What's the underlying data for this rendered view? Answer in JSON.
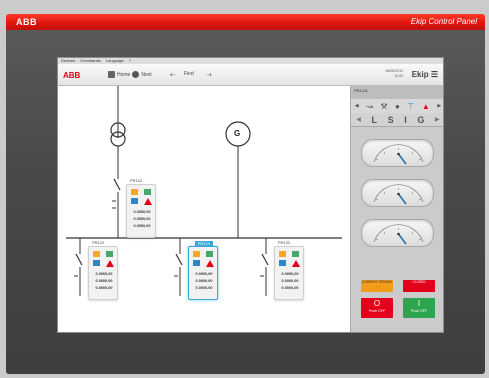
{
  "device": {
    "brand": "ABB",
    "panel_title": "Ekip Control Panel"
  },
  "menubar": {
    "items": [
      "Devices",
      "Commands",
      "Language",
      "?"
    ]
  },
  "toolbar": {
    "logo": "ABB",
    "home_label": "Home",
    "next_label": "Next",
    "back_icon": "arrow-left-icon",
    "forward_icon": "arrow-right-icon",
    "find_label": "Find",
    "status_line1": "06/05/2013",
    "status_line2": "10:00",
    "ekip_label": "Ekip"
  },
  "diagram": {
    "top_card": {
      "title": "PR122",
      "values": [
        "0.0000,00",
        "0.0000,00",
        "0.0000,00"
      ]
    },
    "generator_label": "G",
    "bottom_cards": [
      {
        "title": "PR122",
        "values": [
          "0.0000,00",
          "0.0000,00",
          "0.0000,00"
        ],
        "selected": false
      },
      {
        "title": "PR121",
        "values": [
          "0.0000,00",
          "0.0000,00",
          "0.0000,00"
        ],
        "selected": true
      },
      {
        "title": "PR122",
        "values": [
          "0.0000,00",
          "0.0000,00",
          "0.0000,00"
        ],
        "selected": false
      }
    ]
  },
  "right_panel": {
    "header": "PR121L",
    "tools": [
      "measure-icon",
      "wrench-icon",
      "dial-icon",
      "temperature-icon",
      "warning-icon"
    ],
    "tabs": [
      "L",
      "S",
      "I",
      "G"
    ],
    "gauges": [
      {
        "name": "gauge-current",
        "scale_labels": [
          "0",
          "50",
          "100"
        ]
      },
      {
        "name": "gauge-voltage",
        "scale_labels": [
          "0",
          "50",
          "100"
        ]
      },
      {
        "name": "gauge-power",
        "scale_labels": [
          "0",
          "50",
          "100"
        ]
      }
    ],
    "buttons": {
      "small_left": "CURRENT OPENED",
      "small_right": "CLOSED",
      "open_symbol": "O",
      "open_label": "Push OFF",
      "close_symbol": "I",
      "close_label": "Push OFF"
    }
  }
}
